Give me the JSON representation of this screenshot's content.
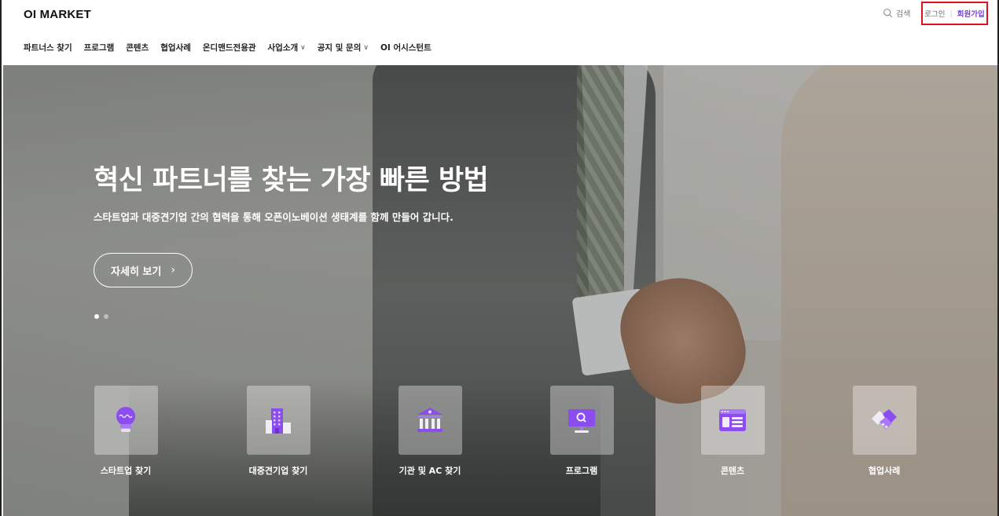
{
  "header": {
    "logo": "OI MARKET",
    "search_label": "검색",
    "login_label": "로그인",
    "separator": "|",
    "signup_label": "회원가입"
  },
  "nav": {
    "items": [
      {
        "label": "파트너스 찾기"
      },
      {
        "label": "프로그램"
      },
      {
        "label": "콘텐츠"
      },
      {
        "label": "협업사례"
      },
      {
        "label": "온디맨드전용관"
      },
      {
        "label": "사업소개",
        "dropdown": true
      },
      {
        "label": "공지 및 문의",
        "dropdown": true
      },
      {
        "label": "OI 어시스턴트"
      }
    ],
    "dropdown_icon": "∨"
  },
  "hero": {
    "title": "혁신 파트너를 찾는 가장 빠른 방법",
    "subtitle": "스타트업과 대중견기업 간의 협력을 통해 오픈이노베이션 생태계를 함께 만들어 갑니다.",
    "more_label": "자세히 보기",
    "more_icon": "›",
    "slide_count": 2,
    "active_slide": 1
  },
  "categories": [
    {
      "label": "스타트업 찾기",
      "icon": "lightbulb-icon"
    },
    {
      "label": "대중견기업 찾기",
      "icon": "building-icon"
    },
    {
      "label": "기관 및 AC 찾기",
      "icon": "institution-icon"
    },
    {
      "label": "프로그램",
      "icon": "monitor-search-icon"
    },
    {
      "label": "콘텐츠",
      "icon": "browser-content-icon"
    },
    {
      "label": "협업사례",
      "icon": "handshake-icon"
    }
  ],
  "colors": {
    "accent": "#7a3ee8",
    "highlight_box": "#e0101f",
    "icon_purple": "#8b4cf0"
  }
}
